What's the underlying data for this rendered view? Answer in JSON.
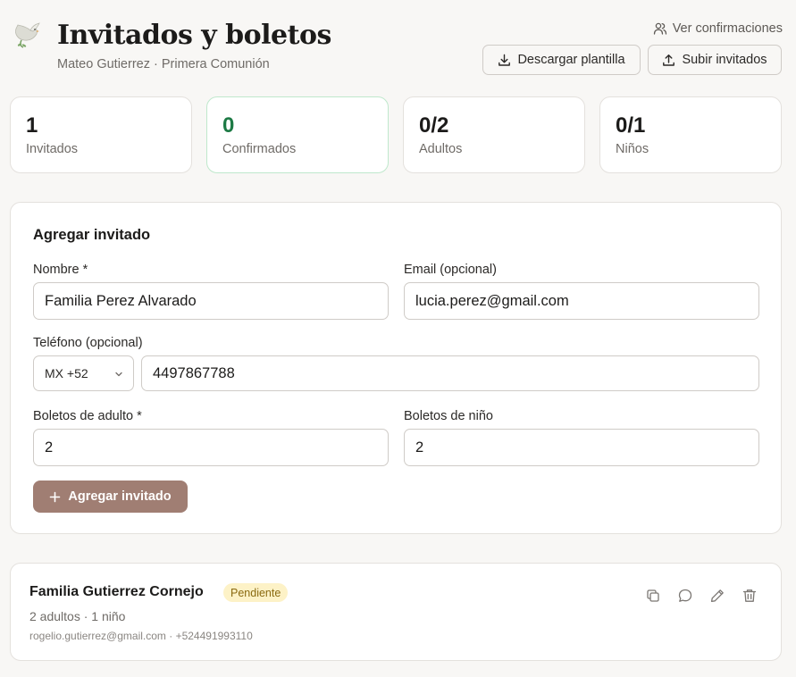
{
  "header": {
    "title": "Invitados y boletos",
    "subtitle": "Mateo Gutierrez · Primera Comunión",
    "ver_confirmaciones": "Ver confirmaciones",
    "download_label": "Descargar plantilla",
    "upload_label": "Subir invitados"
  },
  "stats": [
    {
      "value": "1",
      "label": "Invitados"
    },
    {
      "value": "0",
      "label": "Confirmados"
    },
    {
      "value": "0/2",
      "label": "Adultos"
    },
    {
      "value": "0/1",
      "label": "Niños"
    }
  ],
  "form": {
    "title": "Agregar invitado",
    "name_label": "Nombre *",
    "name_value": "Familia Perez Alvarado",
    "email_label": "Email (opcional)",
    "email_value": "lucia.perez@gmail.com",
    "phone_label": "Teléfono (opcional)",
    "country_code": "MX +52",
    "phone_value": "4497867788",
    "adult_label": "Boletos de adulto *",
    "adult_value": "2",
    "child_label": "Boletos de niño",
    "child_value": "2",
    "submit_label": "Agregar invitado"
  },
  "guests": [
    {
      "name": "Familia Gutierrez Cornejo",
      "status": "Pendiente",
      "tickets": "2 adultos · 1 niño",
      "contact": "rogelio.gutierrez@gmail.com · +524491993110"
    }
  ],
  "colors": {
    "accent": "#a07e73",
    "confirmed_green": "#1d7a45",
    "pending_badge_bg": "#fdf2c7",
    "pending_badge_text": "#8a6a10"
  },
  "icons": [
    "dove-icon",
    "users-icon",
    "download-icon",
    "upload-icon",
    "plus-icon",
    "chevron-down-icon",
    "copy-icon",
    "message-icon",
    "pencil-icon",
    "trash-icon"
  ]
}
